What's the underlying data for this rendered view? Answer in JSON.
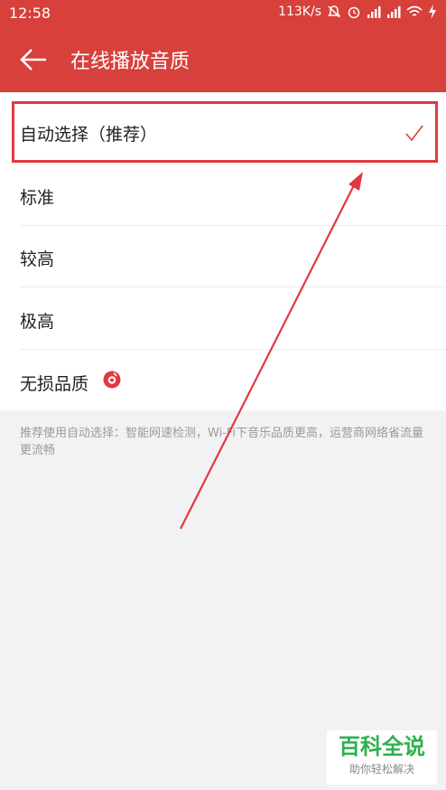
{
  "status_bar": {
    "time": "12:58",
    "net_speed": "113K/s",
    "icons": [
      "mute-bell-icon",
      "alarm-icon",
      "signal-icon",
      "signal-icon",
      "wifi-icon",
      "charging-icon"
    ]
  },
  "app_bar": {
    "title": "在线播放音质",
    "back_icon": "back-arrow-icon"
  },
  "options": [
    {
      "label": "自动选择（推荐）",
      "selected": true
    },
    {
      "label": "标准",
      "selected": false
    },
    {
      "label": "较高",
      "selected": false
    },
    {
      "label": "极高",
      "selected": false
    },
    {
      "label": "无损品质",
      "selected": false,
      "badge_icon": "sq-badge-icon"
    }
  ],
  "hint_text": "推荐使用自动选择：智能网速检测，Wi-Fi下音乐品质更高，运营商网络省流量更流畅",
  "watermark": {
    "title": "百科全说",
    "subtitle": "助你轻松解决"
  },
  "colors": {
    "accent": "#d8403b",
    "annotation": "#e0393f",
    "watermark": "#2bb24c"
  }
}
